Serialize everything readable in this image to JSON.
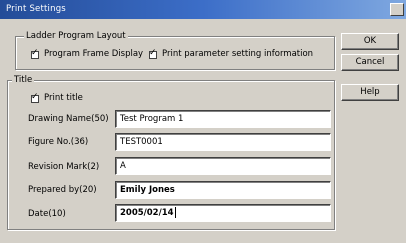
{
  "window": {
    "title": "Print Settings"
  },
  "ladder_group": {
    "legend": "Ladder Program Layout",
    "checkboxes": [
      {
        "label": "Program Frame Display",
        "checked": true
      },
      {
        "label": "Print parameter setting information",
        "checked": true
      }
    ]
  },
  "title_group": {
    "legend": "Title",
    "print_title": {
      "label": "Print title",
      "checked": true
    },
    "fields": [
      {
        "label": "Drawing Name(50)",
        "value": "Test Program 1"
      },
      {
        "label": "Figure No.(36)",
        "value": "TEST0001"
      },
      {
        "label": "Revision Mark(2)",
        "value": "A"
      },
      {
        "label": "Prepared by(20)",
        "value": "Emily Jones"
      },
      {
        "label": "Date(10)",
        "value": "2005/02/14"
      }
    ]
  },
  "buttons": {
    "ok": "OK",
    "cancel": "Cancel",
    "help": "Help"
  },
  "icons": {
    "checkbox_mark": "checkmark-icon"
  }
}
